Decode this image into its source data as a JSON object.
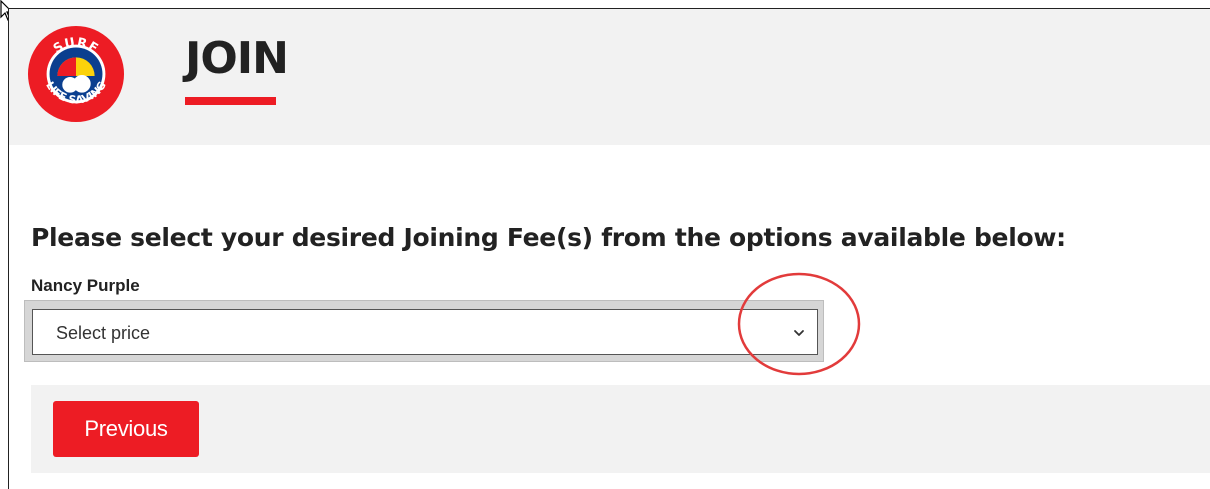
{
  "brand": {
    "logo_top_text": "SURF",
    "logo_bottom_text": "LIFE SAVING",
    "accent_color": "#ed1c24"
  },
  "header": {
    "title": "JOIN"
  },
  "main": {
    "heading": "Please select your desired Joining Fee(s) from the options available below:",
    "member_name": "Nancy Purple",
    "price_select": {
      "selected": "Select price",
      "icon": "chevron-down-icon"
    }
  },
  "footer": {
    "previous_label": "Previous"
  },
  "annotation": {
    "shape": "circle",
    "color": "#e23b3b"
  }
}
